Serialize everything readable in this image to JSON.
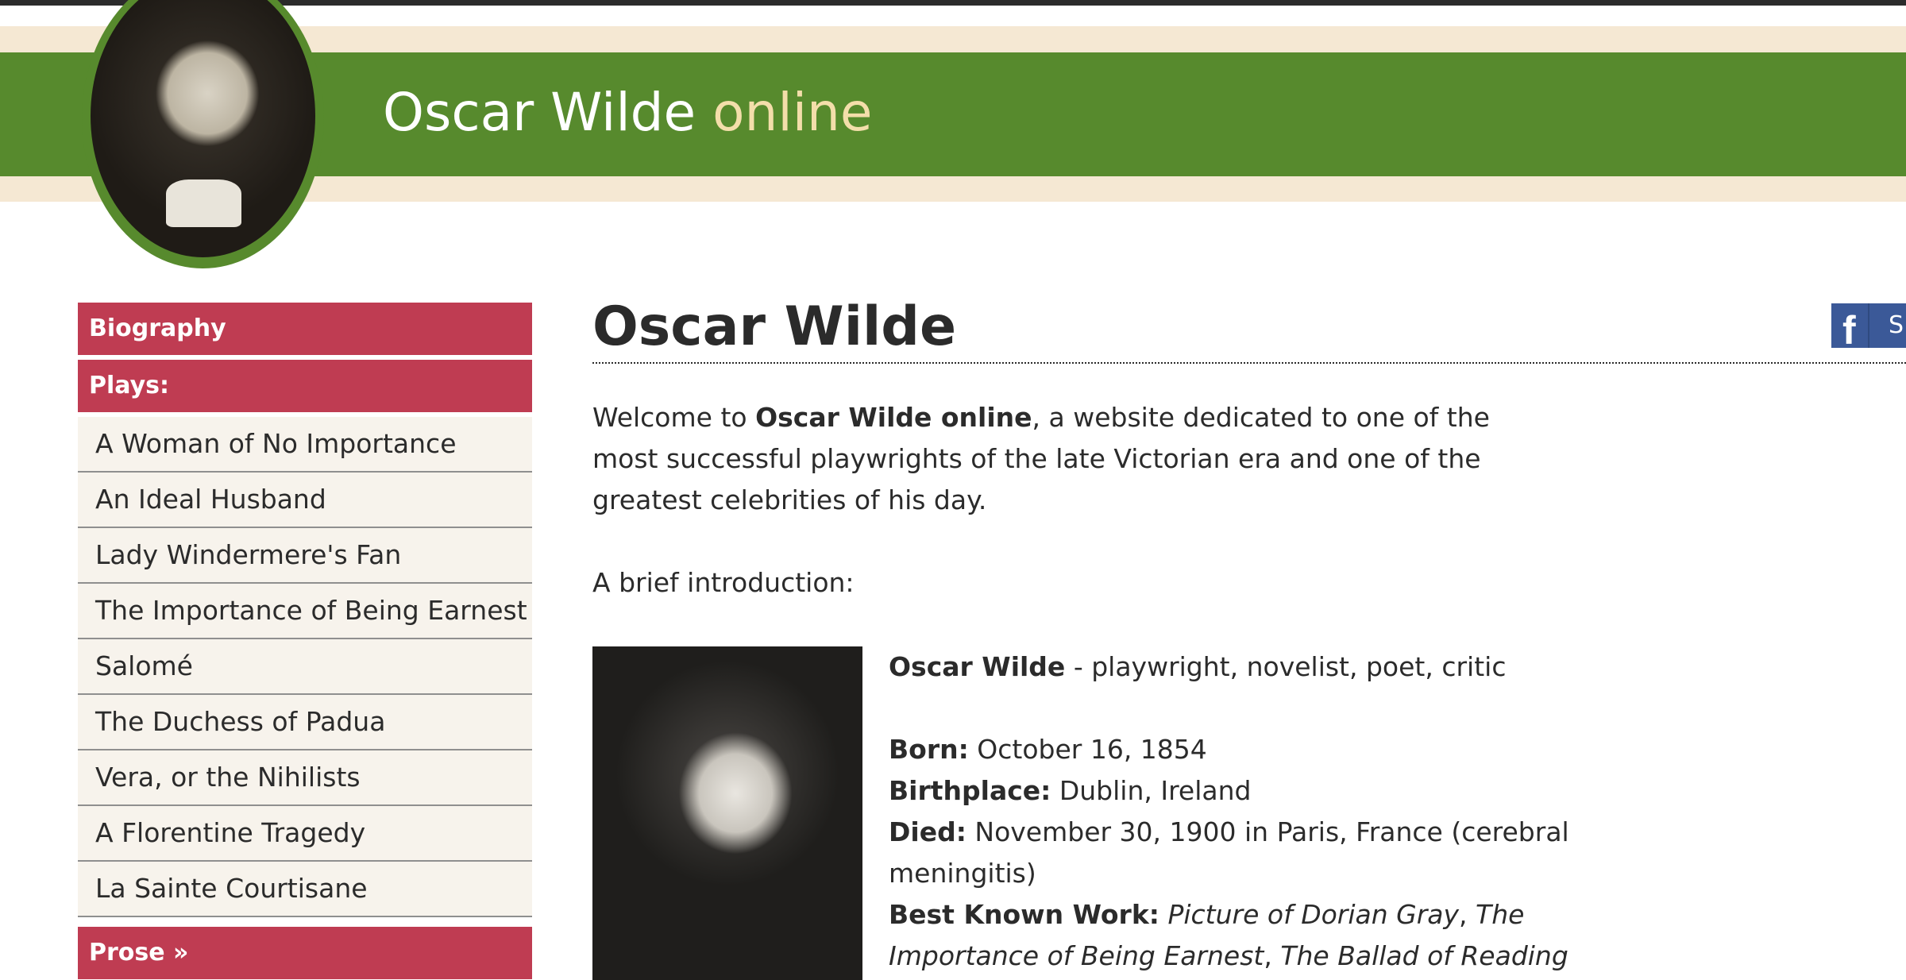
{
  "header": {
    "title_main": "Oscar Wilde",
    "title_accent": "online"
  },
  "sidebar": {
    "biography": "Biography",
    "plays_heading": "Plays:",
    "plays": [
      "A Woman of No Importance",
      "An Ideal Husband",
      "Lady Windermere's Fan",
      "The Importance of Being Earnest",
      "Salomé",
      "The Duchess of Padua",
      "Vera, or the Nihilists",
      "A Florentine Tragedy",
      "La Sainte Courtisane"
    ],
    "prose_heading": "Prose  »"
  },
  "main": {
    "title": "Oscar Wilde",
    "intro_before": "Welcome to ",
    "intro_bold": "Oscar Wilde online",
    "intro_after": ", a website dedicated to one of the most successful playwrights of the late Victorian era and one of the greatest celebrities of his day.",
    "brief": "A brief introduction:",
    "profile": {
      "name": "Oscar Wilde",
      "roles": " - playwright, novelist, poet, critic",
      "born_label": "Born:",
      "born_value": " October 16, 1854",
      "birthplace_label": "Birthplace:",
      "birthplace_value": " Dublin, Ireland",
      "died_label": "Died:",
      "died_value": " November 30, 1900 in Paris, France (cerebral meningitis)",
      "best_label": "Best Known Work:",
      "best_work_1": "Picture of Dorian Gray",
      "best_sep": ", ",
      "best_work_2": "The Importance of Being Earnest",
      "best_sep2": ", ",
      "best_work_3": "The Ballad of Reading"
    }
  },
  "share": {
    "icon": "facebook-icon",
    "label": "S"
  },
  "colors": {
    "header_green": "#578a2d",
    "header_cream": "#f5e8d3",
    "accent_gold": "#f3deaa",
    "nav_red": "#bf3c52",
    "nav_item_bg": "#f7f3ec",
    "facebook_blue": "#3b5998"
  }
}
